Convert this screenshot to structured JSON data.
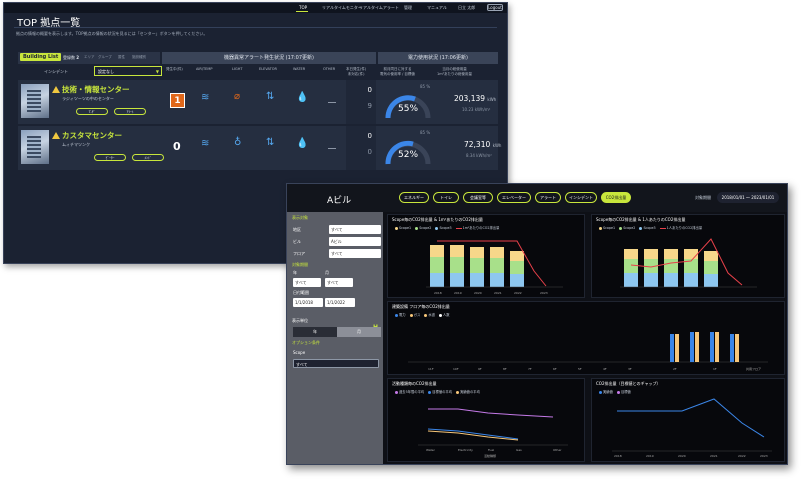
{
  "top_page": {
    "nav": {
      "items": [
        "TOP",
        "リアルタイムモニター",
        "リアルタイムアラート",
        "管理",
        "マニュアル"
      ],
      "user": "日立 太郎",
      "logout": "Logout"
    },
    "title": "TOP 拠点一覧",
    "description": "拠点の情報の概要を表示します。TOP拠点の情報の状況を見るには「センター」ボタンを押してください。",
    "building_list": {
      "title": "Building List",
      "count_label": "登録数",
      "count_value": "2",
      "tabs": [
        "エリア",
        "グループ",
        "属性",
        "施設種別"
      ]
    },
    "sections": {
      "alerts": "機器異常アラート発生状況 (17:07更新)",
      "power": "電力使用状況 (17:06更新)"
    },
    "filter": {
      "label": "インシデント",
      "value": "設定なし"
    },
    "columns": {
      "alert": "発生中(件)",
      "air": "AIR/TEMP",
      "light": "LIGHT",
      "elevator": "ELEVATOR",
      "water": "WATER",
      "other": "OTHER",
      "count": "本日発生(件)\n未対応(件)",
      "demand": "前月同日に対する\n電気の使用率 / 目標値",
      "monthly": "当月の総使用量\n1m²あたりの総使用量"
    },
    "buildings": [
      {
        "name": "技術・情報センター",
        "sub": "ラジィツーツの中のセンター",
        "buttons": [
          "T-ｻﾞ",
          "ｱﾗｰﾄ"
        ],
        "alert_count": "1",
        "today": "0",
        "open": "9",
        "gauge_pct": 55,
        "gauge_top": "85 %",
        "kwh": "203,139",
        "kwh_unit": "kWh",
        "kwh_m2": "10.23 kWh/m²"
      },
      {
        "name": "カスタマセンター",
        "sub": "ムィチマツンク",
        "buttons": [
          "ﾋﾞｰﾀｰ",
          "ﾒﾝﾄﾞ"
        ],
        "alert_count": "0",
        "today": "0",
        "open": "0",
        "gauge_pct": 52,
        "gauge_top": "85 %",
        "kwh": "72,310",
        "kwh_unit": "kWh",
        "kwh_m2": "8.34 kWh/m²"
      }
    ]
  },
  "detail_page": {
    "building": "Aビル",
    "tabs": [
      "エネルギー",
      "トイレ",
      "会議室等",
      "エレベーター",
      "アラート",
      "インシデント",
      "CO2排出量"
    ],
    "active_tab": "CO2排出量",
    "period_label": "対象期間",
    "period_value": "2018/01/01 ～ 2023/01/01",
    "sidebar": {
      "target_title": "表示対象",
      "area_label": "地区",
      "area_value": "すべて",
      "building_label": "ビル",
      "building_value": "Aビル",
      "floor_label": "フロア",
      "floor_value": "すべて",
      "period_title": "対象期間",
      "year_label": "年",
      "month_label": "月",
      "year_value": "すべて",
      "month_value": "すべて",
      "date_title": "日付範囲",
      "date_from": "1/1/2018",
      "date_to": "1/1/2022",
      "unit_title": "表示単位",
      "unit_year": "年",
      "unit_month": "月",
      "option_title": "オプション条件",
      "scope_label": "Scope",
      "scope_value": "すべて"
    },
    "panels": {
      "p1_title": "Scope毎のCO2排出量 & 1m²あたりのCO2排出量",
      "p2_title": "Scope毎のCO2排出量 & 1人あたりのCO2排出量",
      "p3_title": "建築設備 フロア毎のCO2排出量",
      "p4_title": "活動種類毎のCO2排出量",
      "p5_title": "CO2排出量（目標値とのギャップ）"
    },
    "legends": {
      "scopes": [
        "Scope1",
        "Scope2",
        "Scope3"
      ],
      "p1_line": "1m²あたりのCO2排出量",
      "p2_line": "1人あたりのCO2排出量",
      "p3": [
        "電力",
        "ガス",
        "水道",
        "人数"
      ],
      "p4": [
        "過去5年間の平均",
        "目標値の平均",
        "実績値の平均"
      ],
      "p5": [
        "実績値",
        "目標値"
      ]
    },
    "axis": {
      "p1_x": [
        "2018",
        "2019",
        "2020",
        "2021",
        "2022",
        "2023"
      ],
      "p4_x": [
        "Water",
        "Electricity",
        "Fuel",
        "Gas",
        "Other"
      ],
      "p4_xlabel": "活動種類",
      "p5_x": [
        "2018",
        "2019",
        "2020",
        "2021",
        "2022",
        "2023"
      ],
      "p3_x": [
        "11F",
        "10F",
        "9F",
        "8F",
        "7F",
        "6F",
        "5F",
        "4F",
        "3F",
        "2F",
        "1F",
        "共用フロア"
      ]
    },
    "colors": {
      "accent": "#c8e63c",
      "scope1": "#f7d78a",
      "scope2": "#a8e08a",
      "scope3": "#8ec7f0",
      "line_red": "#e8414a",
      "blue": "#3b86e8",
      "orange": "#f7c77a",
      "purple": "#c57ae8"
    }
  }
}
